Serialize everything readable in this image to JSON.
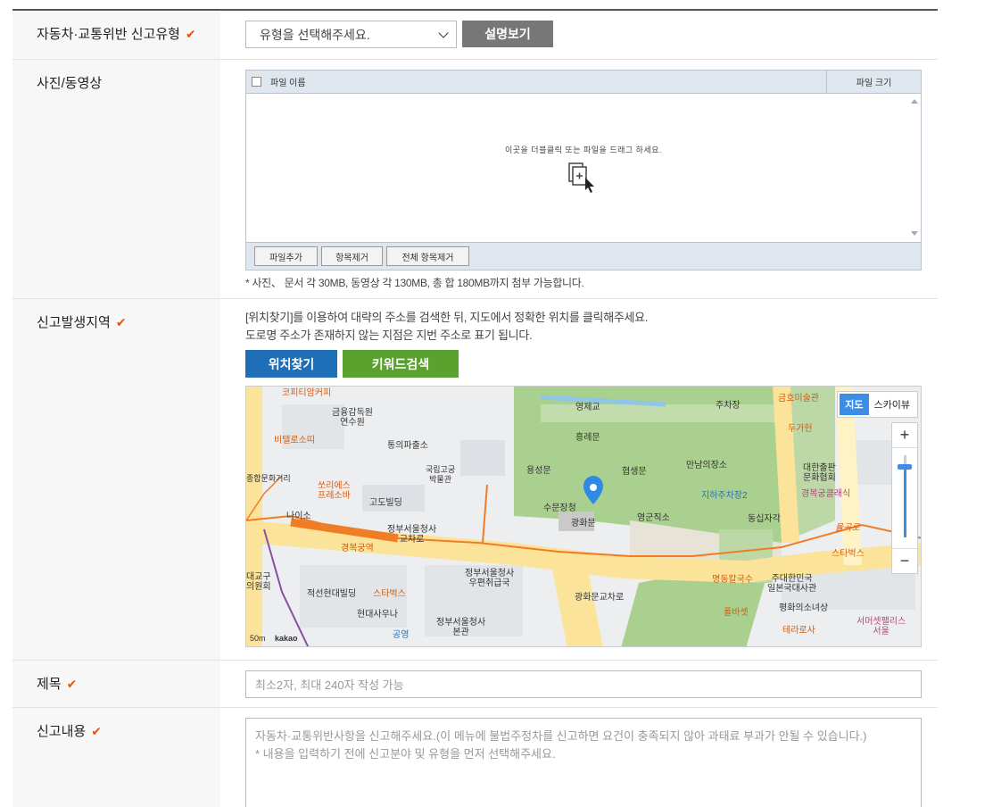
{
  "rows": {
    "type": {
      "label": "자동차·교통위반 신고유형",
      "check": "✔",
      "select_value": "유형을 선택해주세요.",
      "button": "설명보기"
    },
    "upload": {
      "label": "사진/동영상",
      "col_name": "파일 이름",
      "col_size": "파일 크기",
      "hint": "이곳을 더블클릭 또는 파일을 드래그 하세요.",
      "btn_add": "파일추가",
      "btn_remove": "항목제거",
      "btn_remove_all": "전체 항목제거",
      "note": "* 사진、 문서 각 30MB, 동영상 각 130MB, 총 합 180MB까지 첨부 가능합니다."
    },
    "location": {
      "label": "신고발생지역",
      "check": "✔",
      "desc1": "[위치찾기]를 이용하여 대략의 주소를 검색한 뒤, 지도에서 정확한 위치를 클릭해주세요.",
      "desc2": "도로명 주소가 존재하지 않는 지점은 지번 주소로 표기 됩니다.",
      "btn_find": "위치찾기",
      "btn_keyword": "키워드검색",
      "map": {
        "type_map": "지도",
        "type_sky": "스카이뷰",
        "zoom_in": "+",
        "zoom_out": "−",
        "labels": {
          "l1": "영제교",
          "l2": "주차장",
          "l3": "금호미술관",
          "l4": "흥례문",
          "l5": "금융감독원\n연수원",
          "l6": "통의파출소",
          "l7": "비텔로소띠",
          "l8": "두가헌",
          "l9": "국립고궁\n박물관",
          "l10": "용성문",
          "l11": "협생문",
          "l12": "만남의장소",
          "l13": "대한출판\n문화협회",
          "l14": "쏘리에스\n프레소바",
          "l15": "고도빌딩",
          "l16": "수문장청",
          "l17": "지하주차장2",
          "l18": "경복궁클래식",
          "l19": "나이소",
          "l20": "광화문",
          "l21": "영군직소",
          "l22": "동십자각",
          "l23": "정부서울청사\n교차로",
          "l24": "경복궁역",
          "l25": "율곡로",
          "l26": "스타벅스",
          "l27": "정부서울청사\n우편취급국",
          "l28": "명동칼국수",
          "l29": "주대한민국\n일본국대사관",
          "l30": "적선현대빌딩",
          "l31": "스타벅스",
          "l32": "광화문교차로",
          "l33": "현대사우나",
          "l34": "평화의소녀상",
          "l35": "서머셋팰리스\n서울",
          "l36": "정부서울청사\n본관",
          "l37": "공영",
          "l38": "폴바셋",
          "l39": "테라로사",
          "l40": "코피티암커피",
          "l41": "대교구\n의원회",
          "l42": "종합문화거리"
        },
        "scale": "50m",
        "brand": "kakao"
      }
    },
    "title": {
      "label": "제목",
      "check": "✔",
      "placeholder": "최소2자, 최대 240자 작성 가능"
    },
    "content": {
      "label": "신고내용",
      "check": "✔",
      "placeholder1": "자동차·교통위반사항을 신고해주세요.(이 메뉴에 불법주정차를 신고하면 요건이 충족되지 않아 과태료 부과가 안될 수 있습니다.)",
      "placeholder2": "* 내용을 입력하기 전에 신고분야 및 유형을 먼저 선택해주세요."
    }
  },
  "colors": {
    "accent_check": "#e8540c",
    "btn_blue": "#1f6fb8",
    "btn_green": "#59a22e",
    "btn_gray": "#777777"
  }
}
